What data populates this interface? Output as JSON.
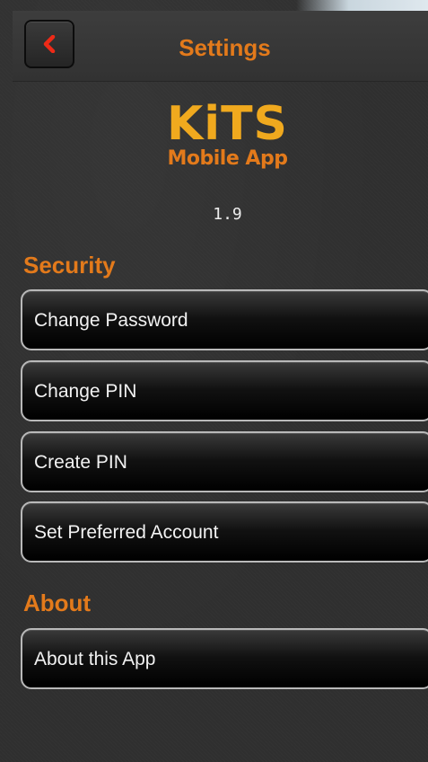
{
  "header": {
    "title": "Settings",
    "back_icon": "chevron-left-icon"
  },
  "logo": {
    "name": "KiTS",
    "subtitle": "Mobile App"
  },
  "version": "1.9",
  "sections": [
    {
      "heading": "Security",
      "items": [
        {
          "label": "Change Password"
        },
        {
          "label": "Change PIN"
        },
        {
          "label": "Create PIN"
        },
        {
          "label": "Set Preferred Account"
        }
      ]
    },
    {
      "heading": "About",
      "items": [
        {
          "label": "About this App"
        }
      ]
    }
  ],
  "colors": {
    "accent": "#e37a1b",
    "logo_yellow": "#f0a91e",
    "background": "#303030",
    "button_border": "#b9b9b9",
    "button_text": "#f2f2f2"
  }
}
